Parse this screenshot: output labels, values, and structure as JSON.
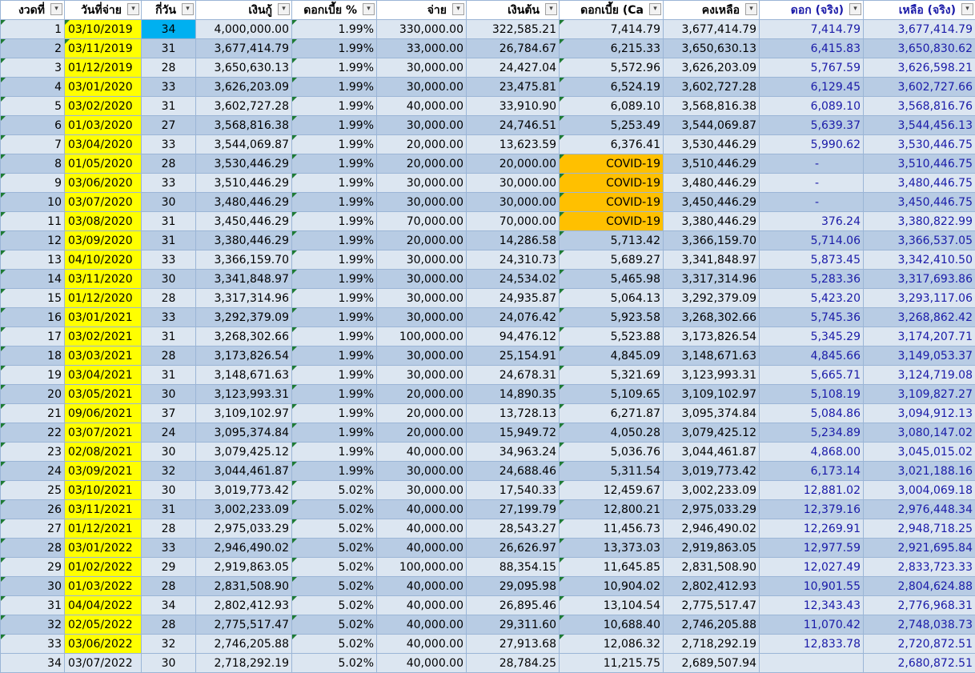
{
  "columns": [
    "งวดที่",
    "วันที่จ่าย",
    "กี่วัน",
    "เงินกู้",
    "ดอกเบี้ย %",
    "จ่าย",
    "เงินต้น",
    "ดอกเบี้ย (Ca",
    "คงเหลือ",
    "ดอก (จริง)",
    "เหลือ (จริง)"
  ],
  "filter_icon": "dropdown-arrow-icon",
  "colors": {
    "header_blue": "#1a1aa8",
    "date_highlight": "#ffff00",
    "covid_highlight": "#ffc000",
    "selected_cell": "#00b0f0",
    "row_light": "#dce6f1",
    "row_dark": "#b8cce4"
  },
  "rows": [
    [
      "1",
      "03/10/2019",
      "34",
      "4,000,000.00",
      "1.99%",
      "330,000.00",
      "322,585.21",
      "7,414.79",
      "3,677,414.79",
      "7,414.79",
      "3,677,414.79"
    ],
    [
      "2",
      "03/11/2019",
      "31",
      "3,677,414.79",
      "1.99%",
      "33,000.00",
      "26,784.67",
      "6,215.33",
      "3,650,630.13",
      "6,415.83",
      "3,650,830.62"
    ],
    [
      "3",
      "01/12/2019",
      "28",
      "3,650,630.13",
      "1.99%",
      "30,000.00",
      "24,427.04",
      "5,572.96",
      "3,626,203.09",
      "5,767.59",
      "3,626,598.21"
    ],
    [
      "4",
      "03/01/2020",
      "33",
      "3,626,203.09",
      "1.99%",
      "30,000.00",
      "23,475.81",
      "6,524.19",
      "3,602,727.28",
      "6,129.45",
      "3,602,727.66"
    ],
    [
      "5",
      "03/02/2020",
      "31",
      "3,602,727.28",
      "1.99%",
      "40,000.00",
      "33,910.90",
      "6,089.10",
      "3,568,816.38",
      "6,089.10",
      "3,568,816.76"
    ],
    [
      "6",
      "01/03/2020",
      "27",
      "3,568,816.38",
      "1.99%",
      "30,000.00",
      "24,746.51",
      "5,253.49",
      "3,544,069.87",
      "5,639.37",
      "3,544,456.13"
    ],
    [
      "7",
      "03/04/2020",
      "33",
      "3,544,069.87",
      "1.99%",
      "20,000.00",
      "13,623.59",
      "6,376.41",
      "3,530,446.29",
      "5,990.62",
      "3,530,446.75"
    ],
    [
      "8",
      "01/05/2020",
      "28",
      "3,530,446.29",
      "1.99%",
      "20,000.00",
      "20,000.00",
      "COVID-19",
      "3,510,446.29",
      "-",
      "3,510,446.75"
    ],
    [
      "9",
      "03/06/2020",
      "33",
      "3,510,446.29",
      "1.99%",
      "30,000.00",
      "30,000.00",
      "COVID-19",
      "3,480,446.29",
      "-",
      "3,480,446.75"
    ],
    [
      "10",
      "03/07/2020",
      "30",
      "3,480,446.29",
      "1.99%",
      "30,000.00",
      "30,000.00",
      "COVID-19",
      "3,450,446.29",
      "-",
      "3,450,446.75"
    ],
    [
      "11",
      "03/08/2020",
      "31",
      "3,450,446.29",
      "1.99%",
      "70,000.00",
      "70,000.00",
      "COVID-19",
      "3,380,446.29",
      "376.24",
      "3,380,822.99"
    ],
    [
      "12",
      "03/09/2020",
      "31",
      "3,380,446.29",
      "1.99%",
      "20,000.00",
      "14,286.58",
      "5,713.42",
      "3,366,159.70",
      "5,714.06",
      "3,366,537.05"
    ],
    [
      "13",
      "04/10/2020",
      "33",
      "3,366,159.70",
      "1.99%",
      "30,000.00",
      "24,310.73",
      "5,689.27",
      "3,341,848.97",
      "5,873.45",
      "3,342,410.50"
    ],
    [
      "14",
      "03/11/2020",
      "30",
      "3,341,848.97",
      "1.99%",
      "30,000.00",
      "24,534.02",
      "5,465.98",
      "3,317,314.96",
      "5,283.36",
      "3,317,693.86"
    ],
    [
      "15",
      "01/12/2020",
      "28",
      "3,317,314.96",
      "1.99%",
      "30,000.00",
      "24,935.87",
      "5,064.13",
      "3,292,379.09",
      "5,423.20",
      "3,293,117.06"
    ],
    [
      "16",
      "03/01/2021",
      "33",
      "3,292,379.09",
      "1.99%",
      "30,000.00",
      "24,076.42",
      "5,923.58",
      "3,268,302.66",
      "5,745.36",
      "3,268,862.42"
    ],
    [
      "17",
      "03/02/2021",
      "31",
      "3,268,302.66",
      "1.99%",
      "100,000.00",
      "94,476.12",
      "5,523.88",
      "3,173,826.54",
      "5,345.29",
      "3,174,207.71"
    ],
    [
      "18",
      "03/03/2021",
      "28",
      "3,173,826.54",
      "1.99%",
      "30,000.00",
      "25,154.91",
      "4,845.09",
      "3,148,671.63",
      "4,845.66",
      "3,149,053.37"
    ],
    [
      "19",
      "03/04/2021",
      "31",
      "3,148,671.63",
      "1.99%",
      "30,000.00",
      "24,678.31",
      "5,321.69",
      "3,123,993.31",
      "5,665.71",
      "3,124,719.08"
    ],
    [
      "20",
      "03/05/2021",
      "30",
      "3,123,993.31",
      "1.99%",
      "20,000.00",
      "14,890.35",
      "5,109.65",
      "3,109,102.97",
      "5,108.19",
      "3,109,827.27"
    ],
    [
      "21",
      "09/06/2021",
      "37",
      "3,109,102.97",
      "1.99%",
      "20,000.00",
      "13,728.13",
      "6,271.87",
      "3,095,374.84",
      "5,084.86",
      "3,094,912.13"
    ],
    [
      "22",
      "03/07/2021",
      "24",
      "3,095,374.84",
      "1.99%",
      "20,000.00",
      "15,949.72",
      "4,050.28",
      "3,079,425.12",
      "5,234.89",
      "3,080,147.02"
    ],
    [
      "23",
      "02/08/2021",
      "30",
      "3,079,425.12",
      "1.99%",
      "40,000.00",
      "34,963.24",
      "5,036.76",
      "3,044,461.87",
      "4,868.00",
      "3,045,015.02"
    ],
    [
      "24",
      "03/09/2021",
      "32",
      "3,044,461.87",
      "1.99%",
      "30,000.00",
      "24,688.46",
      "5,311.54",
      "3,019,773.42",
      "6,173.14",
      "3,021,188.16"
    ],
    [
      "25",
      "03/10/2021",
      "30",
      "3,019,773.42",
      "5.02%",
      "30,000.00",
      "17,540.33",
      "12,459.67",
      "3,002,233.09",
      "12,881.02",
      "3,004,069.18"
    ],
    [
      "26",
      "03/11/2021",
      "31",
      "3,002,233.09",
      "5.02%",
      "40,000.00",
      "27,199.79",
      "12,800.21",
      "2,975,033.29",
      "12,379.16",
      "2,976,448.34"
    ],
    [
      "27",
      "01/12/2021",
      "28",
      "2,975,033.29",
      "5.02%",
      "40,000.00",
      "28,543.27",
      "11,456.73",
      "2,946,490.02",
      "12,269.91",
      "2,948,718.25"
    ],
    [
      "28",
      "03/01/2022",
      "33",
      "2,946,490.02",
      "5.02%",
      "40,000.00",
      "26,626.97",
      "13,373.03",
      "2,919,863.05",
      "12,977.59",
      "2,921,695.84"
    ],
    [
      "29",
      "01/02/2022",
      "29",
      "2,919,863.05",
      "5.02%",
      "100,000.00",
      "88,354.15",
      "11,645.85",
      "2,831,508.90",
      "12,027.49",
      "2,833,723.33"
    ],
    [
      "30",
      "01/03/2022",
      "28",
      "2,831,508.90",
      "5.02%",
      "40,000.00",
      "29,095.98",
      "10,904.02",
      "2,802,412.93",
      "10,901.55",
      "2,804,624.88"
    ],
    [
      "31",
      "04/04/2022",
      "34",
      "2,802,412.93",
      "5.02%",
      "40,000.00",
      "26,895.46",
      "13,104.54",
      "2,775,517.47",
      "12,343.43",
      "2,776,968.31"
    ],
    [
      "32",
      "02/05/2022",
      "28",
      "2,775,517.47",
      "5.02%",
      "40,000.00",
      "29,311.60",
      "10,688.40",
      "2,746,205.88",
      "11,070.42",
      "2,748,038.73"
    ],
    [
      "33",
      "03/06/2022",
      "32",
      "2,746,205.88",
      "5.02%",
      "40,000.00",
      "27,913.68",
      "12,086.32",
      "2,718,292.19",
      "12,833.78",
      "2,720,872.51"
    ],
    [
      "34",
      "03/07/2022",
      "30",
      "2,718,292.19",
      "5.02%",
      "40,000.00",
      "28,784.25",
      "11,215.75",
      "2,689,507.94",
      "",
      "2,680,872.51"
    ]
  ]
}
